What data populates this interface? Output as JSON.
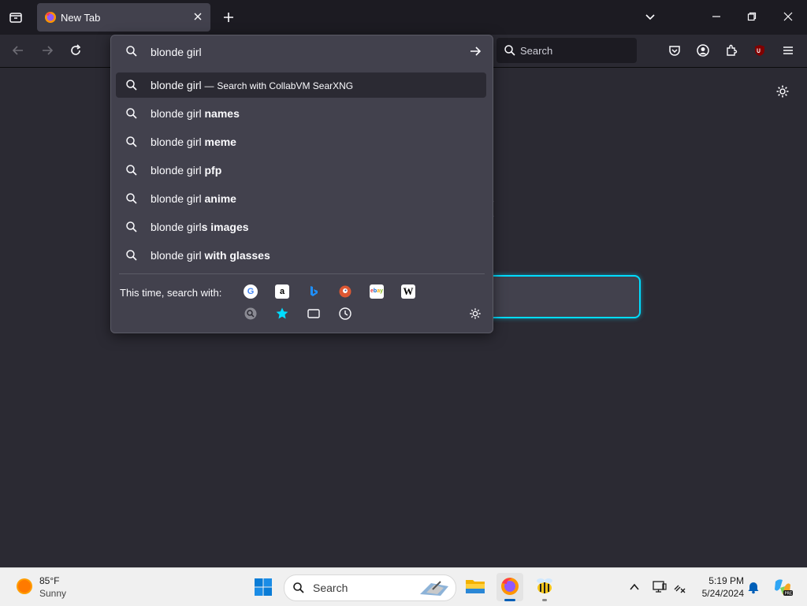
{
  "browser": {
    "tab_title": "New Tab",
    "nav_search_placeholder": "Search"
  },
  "urlbar": {
    "query": "blonde girl",
    "heuristic": {
      "text": "blonde girl",
      "separator": "—",
      "action": "Search with CollabVM SearXNG"
    },
    "suggestions": [
      {
        "prefix": "blonde girl ",
        "bold": "names"
      },
      {
        "prefix": "blonde girl ",
        "bold": "meme"
      },
      {
        "prefix": "blonde girl ",
        "bold": "pfp"
      },
      {
        "prefix": "blonde girl ",
        "bold": "anime"
      },
      {
        "prefix": "blonde girl",
        "bold": "s images"
      },
      {
        "prefix": "blonde girl ",
        "bold": "with glasses"
      }
    ],
    "oneoff_label": "This time, search with:",
    "engines": [
      "google-icon",
      "amazon-icon",
      "bing-icon",
      "duckduckgo-icon",
      "ebay-icon",
      "wikipedia-icon"
    ],
    "modes": [
      "searxng-icon",
      "bookmarks-star-icon",
      "tabs-icon",
      "history-icon"
    ]
  },
  "taskbar": {
    "weather_temp": "85°F",
    "weather_condition": "Sunny",
    "search_placeholder": "Search",
    "time": "5:19 PM",
    "date": "5/24/2024"
  }
}
